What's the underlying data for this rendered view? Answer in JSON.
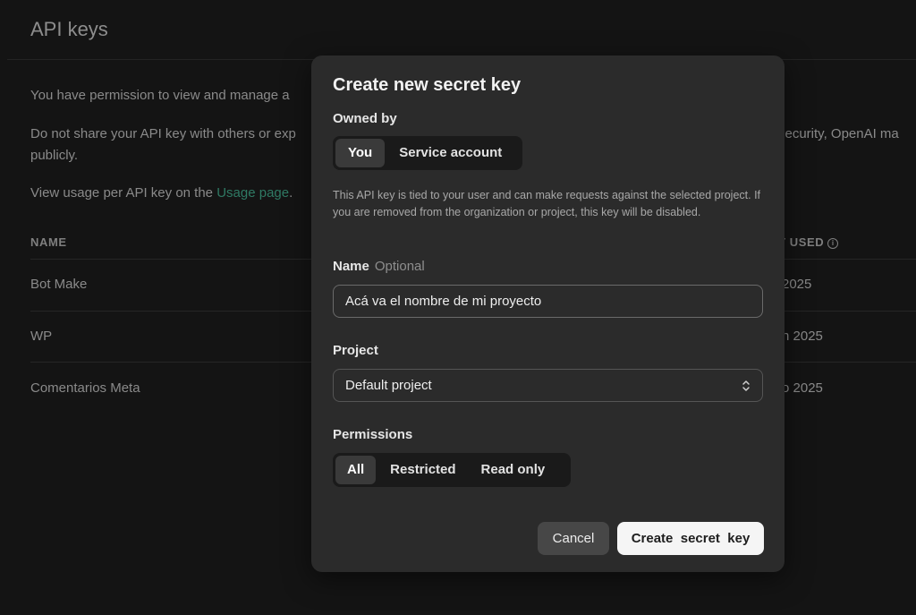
{
  "background": {
    "title": "API keys",
    "para1": "You have permission to view and manage a",
    "para2": "Do not share your API key with others or exp",
    "para2_right": "security, OpenAI ma",
    "para2_line2": "publicly.",
    "para3_prefix": "View usage per API key on the ",
    "para3_link": "Usage page",
    "para3_suffix": ".",
    "columns": {
      "name": "NAME",
      "last_used": "T USED"
    },
    "rows": [
      {
        "name": "Bot Make",
        "last_used": "2025"
      },
      {
        "name": "WP",
        "last_used": "n 2025"
      },
      {
        "name": "Comentarios Meta",
        "last_used": "o 2025"
      }
    ]
  },
  "modal": {
    "title": "Create new secret key",
    "owned_by": {
      "label": "Owned by",
      "options": [
        "You",
        "Service account"
      ],
      "selected": "You"
    },
    "help_text": "This API key is tied to your user and can make requests against the selected project. If you are removed from the organization or project, this key will be disabled.",
    "name_field": {
      "label": "Name",
      "optional": "Optional",
      "value": "Acá va el nombre de mi proyecto"
    },
    "project": {
      "label": "Project",
      "selected": "Default project"
    },
    "permissions": {
      "label": "Permissions",
      "options": [
        "All",
        "Restricted",
        "Read only"
      ],
      "selected": "All"
    },
    "buttons": {
      "cancel": "Cancel",
      "create": "Create  secret  key"
    }
  },
  "icons": {
    "info": "info-circle-icon",
    "chevron": "chevron-up-down-icon"
  }
}
